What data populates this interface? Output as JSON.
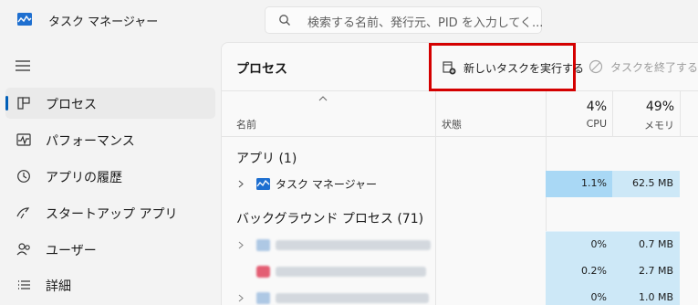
{
  "window": {
    "title": "タスク マネージャー",
    "search_placeholder": "検索する名前、発行元、PID を入力してく..."
  },
  "sidebar": {
    "items": [
      {
        "label": "プロセス",
        "icon": "processes-icon",
        "active": true
      },
      {
        "label": "パフォーマンス",
        "icon": "performance-icon",
        "active": false
      },
      {
        "label": "アプリの履歴",
        "icon": "app-history-icon",
        "active": false
      },
      {
        "label": "スタートアップ アプリ",
        "icon": "startup-apps-icon",
        "active": false
      },
      {
        "label": "ユーザー",
        "icon": "users-icon",
        "active": false
      },
      {
        "label": "詳細",
        "icon": "details-icon",
        "active": false
      }
    ]
  },
  "toolbar": {
    "page_title": "プロセス",
    "run_new_task_label": "新しいタスクを実行する",
    "end_task_label": "タスクを終了する"
  },
  "columns": {
    "name": "名前",
    "status": "状態",
    "cpu_percent": "4%",
    "cpu_label": "CPU",
    "memory_percent": "49%",
    "memory_label": "メモリ"
  },
  "groups": {
    "apps_label": "アプリ (1)",
    "background_label": "バックグラウンド プロセス (71)"
  },
  "rows": [
    {
      "name": "タスク マネージャー",
      "cpu": "1.1%",
      "memory": "62.5 MB"
    },
    {
      "name": "",
      "cpu": "0%",
      "memory": "0.7 MB"
    },
    {
      "name": "",
      "cpu": "0.2%",
      "memory": "2.7 MB"
    },
    {
      "name": "",
      "cpu": "0%",
      "memory": "1.0 MB"
    }
  ],
  "colors": {
    "accent": "#005fb8",
    "highlight_border": "#d40000",
    "heat_cell": "#cde8f7",
    "heat_cell_strong": "#a9d8f5"
  }
}
